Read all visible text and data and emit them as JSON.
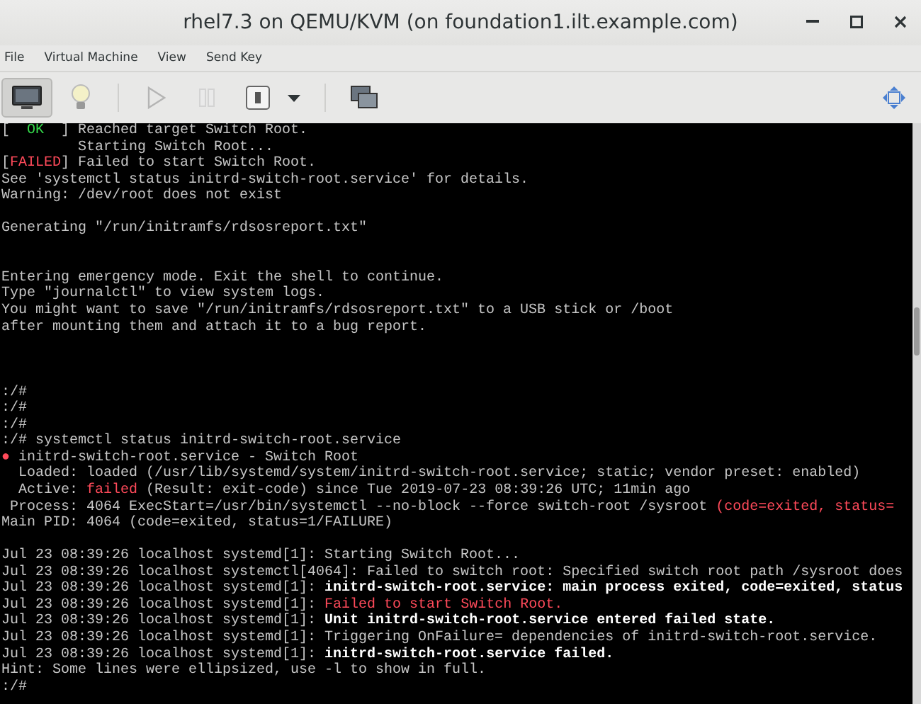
{
  "window": {
    "title": "rhel7.3 on QEMU/KVM (on foundation1.ilt.example.com)"
  },
  "menu": [
    "File",
    "Virtual Machine",
    "View",
    "Send Key"
  ],
  "toolbar": [
    {
      "kind": "monitor",
      "selected": true,
      "disabled": false
    },
    {
      "kind": "bulb",
      "selected": false,
      "disabled": false
    },
    {
      "kind": "separator"
    },
    {
      "kind": "play",
      "selected": false,
      "disabled": true
    },
    {
      "kind": "pause",
      "selected": false,
      "disabled": true
    },
    {
      "kind": "power",
      "selected": false,
      "disabled": false,
      "has_menu": true
    },
    {
      "kind": "separator"
    },
    {
      "kind": "screens",
      "selected": false,
      "disabled": false
    }
  ],
  "terminal": {
    "lines": [
      {
        "kind": "text",
        "segments": [
          {
            "text": "[  ",
            "kind": "normal"
          },
          {
            "text": "OK",
            "kind": "green"
          },
          {
            "text": "  ] Reached target Switch Root.",
            "kind": "normal"
          }
        ]
      },
      {
        "kind": "text",
        "segments": [
          {
            "text": "         Starting Switch Root...",
            "kind": "normal"
          }
        ]
      },
      {
        "kind": "text",
        "segments": [
          {
            "text": "[",
            "kind": "normal"
          },
          {
            "text": "FAILED",
            "kind": "red"
          },
          {
            "text": "] Failed to start Switch Root.",
            "kind": "normal"
          }
        ]
      },
      {
        "kind": "text",
        "segments": [
          {
            "text": "See 'systemctl status initrd-switch-root.service' for details.",
            "kind": "normal"
          }
        ]
      },
      {
        "kind": "text",
        "segments": [
          {
            "text": "Warning: /dev/root does not exist",
            "kind": "normal"
          }
        ]
      },
      {
        "kind": "blank"
      },
      {
        "kind": "text",
        "segments": [
          {
            "text": "Generating \"/run/initramfs/rdsosreport.txt\"",
            "kind": "normal"
          }
        ]
      },
      {
        "kind": "blank"
      },
      {
        "kind": "blank"
      },
      {
        "kind": "text",
        "segments": [
          {
            "text": "Entering emergency mode. Exit the shell to continue.",
            "kind": "normal"
          }
        ]
      },
      {
        "kind": "text",
        "segments": [
          {
            "text": "Type \"journalctl\" to view system logs.",
            "kind": "normal"
          }
        ]
      },
      {
        "kind": "text",
        "segments": [
          {
            "text": "You might want to save \"/run/initramfs/rdsosreport.txt\" to a USB stick or /boot",
            "kind": "normal"
          }
        ]
      },
      {
        "kind": "text",
        "segments": [
          {
            "text": "after mounting them and attach it to a bug report.",
            "kind": "normal"
          }
        ]
      },
      {
        "kind": "blank"
      },
      {
        "kind": "blank"
      },
      {
        "kind": "blank"
      },
      {
        "kind": "text",
        "segments": [
          {
            "text": ":/#",
            "kind": "normal"
          }
        ]
      },
      {
        "kind": "text",
        "segments": [
          {
            "text": ":/#",
            "kind": "normal"
          }
        ]
      },
      {
        "kind": "text",
        "segments": [
          {
            "text": ":/#",
            "kind": "normal"
          }
        ]
      },
      {
        "kind": "text",
        "segments": [
          {
            "text": ":/# systemctl status initrd-switch-root.service",
            "kind": "normal"
          }
        ]
      },
      {
        "kind": "text",
        "segments": [
          {
            "text": "●",
            "kind": "red"
          },
          {
            "text": " initrd-switch-root.service - Switch Root",
            "kind": "normal"
          }
        ]
      },
      {
        "kind": "text",
        "segments": [
          {
            "text": "  Loaded: loaded (/usr/lib/systemd/system/initrd-switch-root.service; static; vendor preset: enabled)",
            "kind": "normal"
          }
        ]
      },
      {
        "kind": "text",
        "segments": [
          {
            "text": "  Active: ",
            "kind": "normal"
          },
          {
            "text": "failed",
            "kind": "red"
          },
          {
            "text": " (Result: exit-code) since Tue 2019-07-23 08:39:26 UTC; 11min ago",
            "kind": "normal"
          }
        ]
      },
      {
        "kind": "text",
        "segments": [
          {
            "text": " Process: 4064 ExecStart=/usr/bin/systemctl --no-block --force switch-root /sysroot ",
            "kind": "normal"
          },
          {
            "text": "(code=exited, status=",
            "kind": "red"
          }
        ]
      },
      {
        "kind": "text",
        "segments": [
          {
            "text": "Main PID: 4064 (code=exited, status=1/FAILURE)",
            "kind": "normal"
          }
        ]
      },
      {
        "kind": "blank"
      },
      {
        "kind": "text",
        "segments": [
          {
            "text": "Jul 23 08:39:26 localhost systemd[1]: Starting Switch Root...",
            "kind": "normal"
          }
        ]
      },
      {
        "kind": "text",
        "segments": [
          {
            "text": "Jul 23 08:39:26 localhost systemctl[4064]: Failed to switch root: Specified switch root path /sysroot does",
            "kind": "normal"
          }
        ]
      },
      {
        "kind": "text",
        "segments": [
          {
            "text": "Jul 23 08:39:26 localhost systemd[1]: ",
            "kind": "normal"
          },
          {
            "text": "initrd-switch-root.service: main process exited, code=exited, status",
            "kind": "bold"
          }
        ]
      },
      {
        "kind": "text",
        "segments": [
          {
            "text": "Jul 23 08:39:26 localhost systemd[1]: ",
            "kind": "normal"
          },
          {
            "text": "Failed to start Switch Root.",
            "kind": "red"
          }
        ]
      },
      {
        "kind": "text",
        "segments": [
          {
            "text": "Jul 23 08:39:26 localhost systemd[1]: ",
            "kind": "normal"
          },
          {
            "text": "Unit initrd-switch-root.service entered failed state.",
            "kind": "bold"
          }
        ]
      },
      {
        "kind": "text",
        "segments": [
          {
            "text": "Jul 23 08:39:26 localhost systemd[1]: Triggering OnFailure= dependencies of initrd-switch-root.service.",
            "kind": "normal"
          }
        ]
      },
      {
        "kind": "text",
        "segments": [
          {
            "text": "Jul 23 08:39:26 localhost systemd[1]: ",
            "kind": "normal"
          },
          {
            "text": "initrd-switch-root.service failed.",
            "kind": "bold"
          }
        ]
      },
      {
        "kind": "text",
        "segments": [
          {
            "text": "Hint: Some lines were ellipsized, use -l to show in full.",
            "kind": "normal"
          }
        ]
      },
      {
        "kind": "text",
        "segments": [
          {
            "text": ":/#",
            "kind": "normal"
          }
        ]
      }
    ]
  }
}
